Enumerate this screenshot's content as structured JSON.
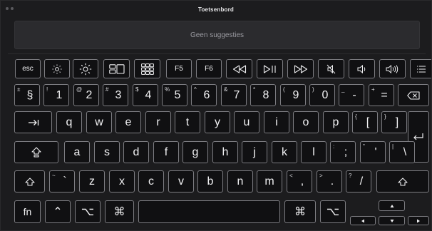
{
  "window": {
    "title": "Toetsenbord"
  },
  "suggestions": {
    "text": "Geen suggesties"
  },
  "function_row": {
    "esc": "esc",
    "brightness_down": "brightness-down",
    "brightness_up": "brightness-up",
    "mission_control": "mission-control",
    "launchpad": "launchpad",
    "f5": "F5",
    "f6": "F6",
    "rewind": "rewind",
    "play_pause": "play-pause",
    "fast_forward": "fast-forward",
    "mute": "mute",
    "volume_down": "volume-down",
    "volume_up": "volume-up",
    "list": "list"
  },
  "number_row": [
    {
      "shift": "±",
      "main": "§"
    },
    {
      "shift": "!",
      "main": "1"
    },
    {
      "shift": "@",
      "main": "2"
    },
    {
      "shift": "#",
      "main": "3"
    },
    {
      "shift": "$",
      "main": "4"
    },
    {
      "shift": "%",
      "main": "5"
    },
    {
      "shift": "^",
      "main": "6"
    },
    {
      "shift": "&",
      "main": "7"
    },
    {
      "shift": "*",
      "main": "8"
    },
    {
      "shift": "(",
      "main": "9"
    },
    {
      "shift": ")",
      "main": "0"
    },
    {
      "shift": "_",
      "main": "-"
    },
    {
      "shift": "+",
      "main": "="
    }
  ],
  "top_row": [
    "q",
    "w",
    "e",
    "r",
    "t",
    "y",
    "u",
    "i",
    "o",
    "p"
  ],
  "top_row_extra": [
    {
      "shift": "{",
      "main": "["
    },
    {
      "shift": "}",
      "main": "]"
    }
  ],
  "home_row": [
    "a",
    "s",
    "d",
    "f",
    "g",
    "h",
    "j",
    "k",
    "l"
  ],
  "home_row_extra": [
    {
      "shift": ":",
      "main": ";"
    },
    {
      "shift": "\"",
      "main": "'"
    },
    {
      "shift": "|",
      "main": "\\"
    }
  ],
  "bottom_row_first": {
    "shift": "~",
    "main": "`"
  },
  "bottom_row": [
    "z",
    "x",
    "c",
    "v",
    "b",
    "n",
    "m"
  ],
  "bottom_row_extra": [
    {
      "shift": "<",
      "main": ","
    },
    {
      "shift": ">",
      "main": "."
    },
    {
      "shift": "?",
      "main": "/"
    }
  ],
  "modifiers": {
    "fn": "fn",
    "control": "⌃",
    "option": "⌥",
    "command": "⌘",
    "tab": "⇥",
    "caps": "⇪",
    "shift": "⇧",
    "delete": "⌫",
    "return": "↩"
  }
}
